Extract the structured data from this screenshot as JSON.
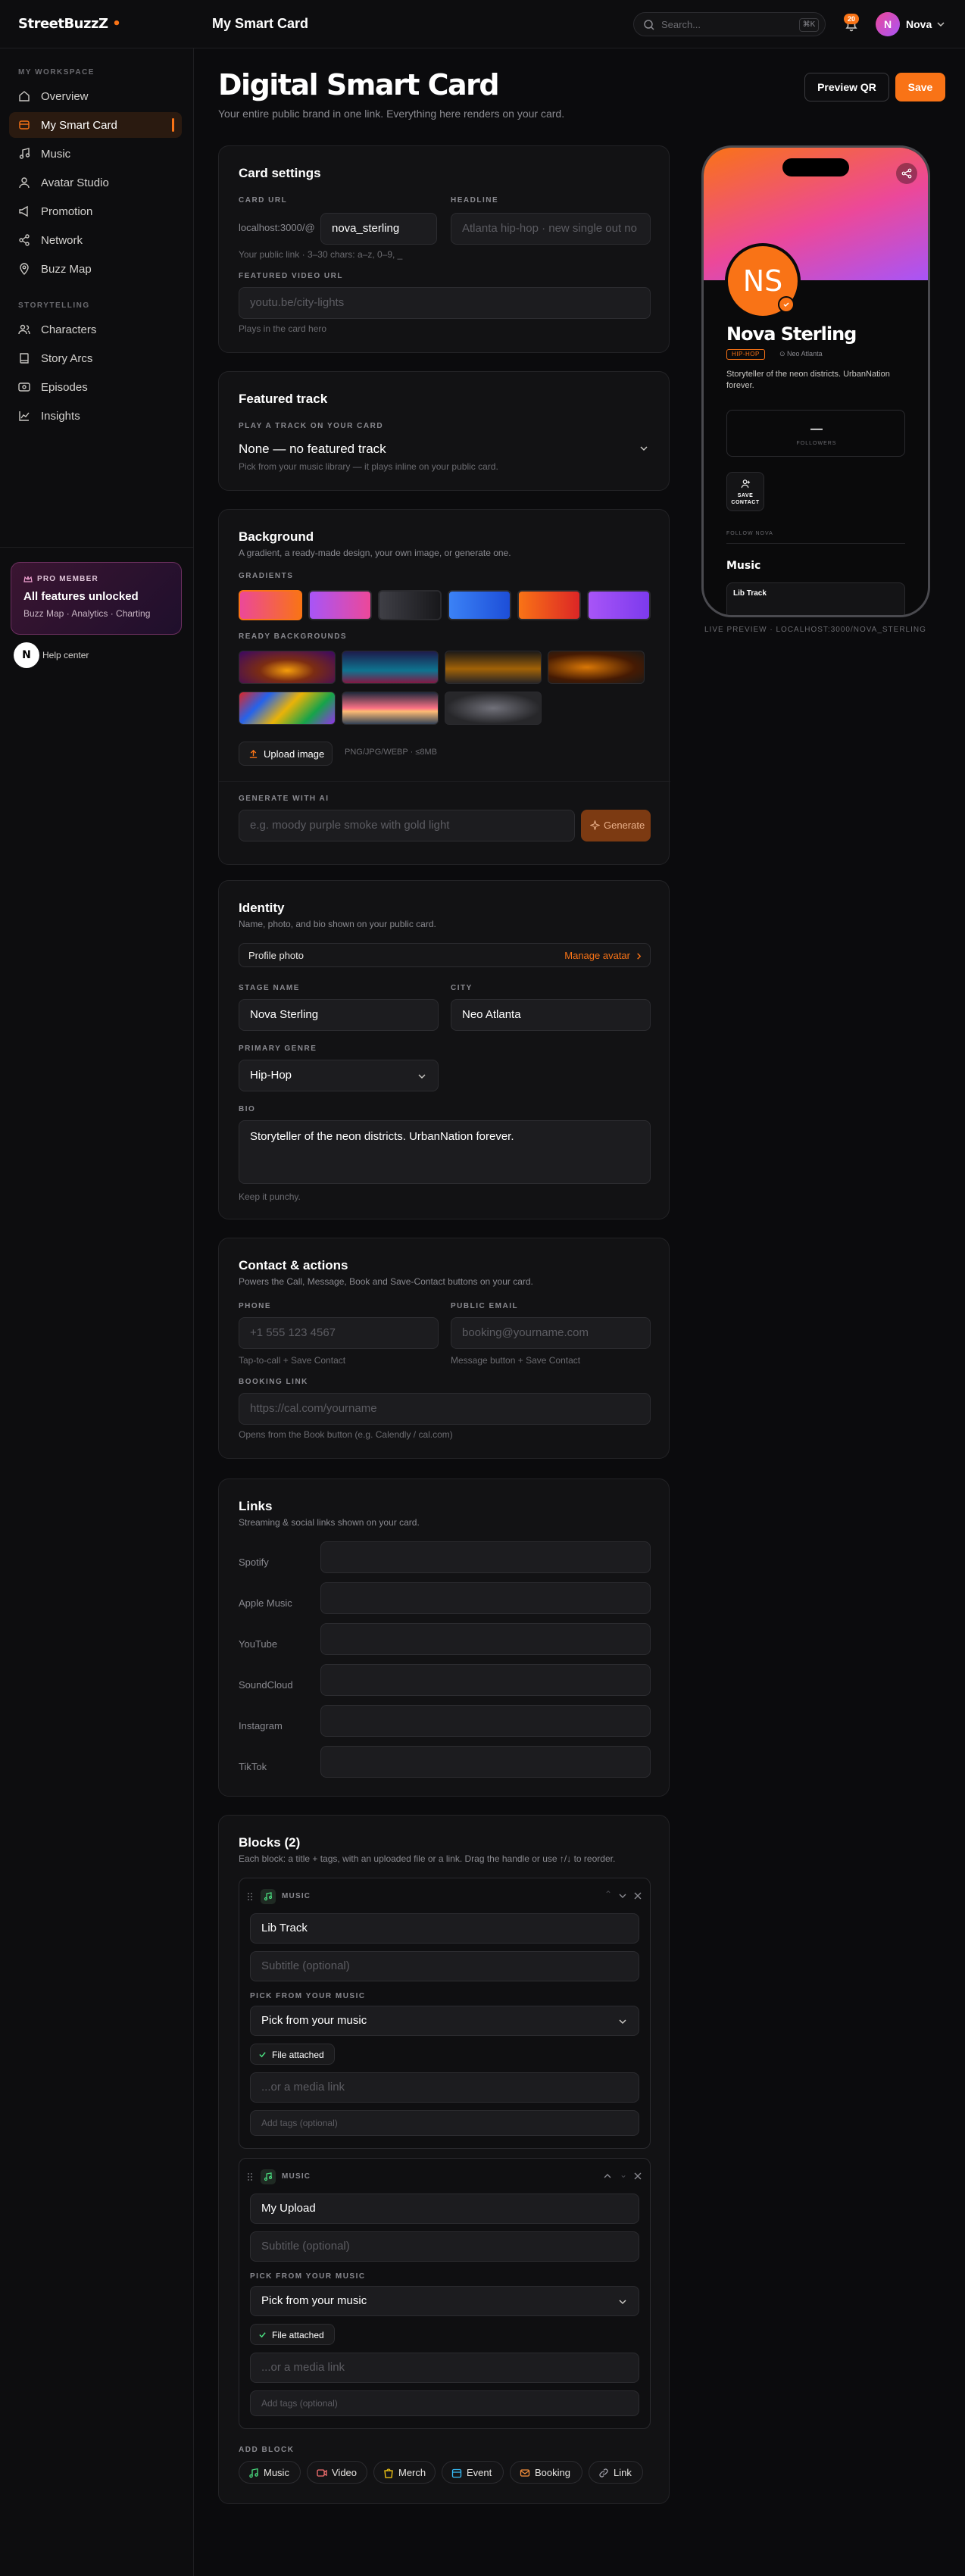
{
  "brand": {
    "name": "StreetBuzzZ",
    "dot": "•"
  },
  "header": {
    "title": "My Smart Card",
    "search_placeholder": "Search...",
    "search_kbd": "⌘K",
    "notif_count": "20",
    "user_initial": "N",
    "user_name": "Nova"
  },
  "sidebar": {
    "workspace_label": "MY WORKSPACE",
    "workspace_items": [
      {
        "label": "Overview",
        "icon": "home-icon"
      },
      {
        "label": "My Smart Card",
        "icon": "card-icon",
        "active": true
      },
      {
        "label": "Music",
        "icon": "music-note-icon"
      },
      {
        "label": "Avatar Studio",
        "icon": "user-icon"
      },
      {
        "label": "Promotion",
        "icon": "megaphone-icon"
      },
      {
        "label": "Network",
        "icon": "share-icon"
      },
      {
        "label": "Buzz Map",
        "icon": "map-pin-icon"
      }
    ],
    "story_label": "STORYTELLING",
    "story_items": [
      {
        "label": "Characters",
        "icon": "users-icon"
      },
      {
        "label": "Story Arcs",
        "icon": "book-icon"
      },
      {
        "label": "Episodes",
        "icon": "film-icon"
      },
      {
        "label": "Insights",
        "icon": "chart-icon"
      }
    ],
    "pro": {
      "label": "PRO MEMBER",
      "title": "All features unlocked",
      "features": "Buzz Map · Analytics · Charting"
    },
    "help": {
      "initial": "N",
      "label": "Help center"
    }
  },
  "page": {
    "title": "Digital Smart Card",
    "subtitle": "Your entire public brand in one link. Everything here renders on your card.",
    "preview_qr": "Preview QR",
    "save": "Save"
  },
  "card_settings": {
    "title": "Card settings",
    "url_label": "CARD URL",
    "url_prefix": "localhost:3000/@",
    "url_value": "nova_sterling",
    "url_hint": "Your public link · 3–30 chars: a–z, 0–9, _",
    "headline_label": "HEADLINE",
    "headline_placeholder": "Atlanta hip-hop · new single out no",
    "video_label": "FEATURED VIDEO URL",
    "video_placeholder": "youtu.be/city-lights",
    "video_hint": "Plays in the card hero"
  },
  "featured": {
    "title": "Featured track",
    "label": "PLAY A TRACK ON YOUR CARD",
    "value": "None — no featured track",
    "hint": "Pick from your music library — it plays inline on your public card."
  },
  "background": {
    "title": "Background",
    "subtitle": "A gradient, a ready-made design, your own image, or generate one.",
    "gradients_label": "GRADIENTS",
    "gradients": [
      "linear-gradient(90deg,#ec4899,#f97316)",
      "linear-gradient(90deg,#a855f7,#ec4899)",
      "linear-gradient(90deg,#3f3f46,#18181b)",
      "linear-gradient(90deg,#3b82f6,#1d4ed8)",
      "linear-gradient(90deg,#f97316,#dc2626)",
      "linear-gradient(90deg,#a855f7,#7c3aed)"
    ],
    "ready_label": "READY BACKGROUNDS",
    "upload": "Upload image",
    "upload_hint": "PNG/JPG/WEBP · ≤8MB",
    "ai_label": "GENERATE WITH AI",
    "ai_placeholder": "e.g. moody purple smoke with gold light",
    "ai_button": "Generate"
  },
  "identity": {
    "title": "Identity",
    "subtitle": "Name, photo, and bio shown on your public card.",
    "photo_label": "Profile photo",
    "manage": "Manage avatar",
    "stage_label": "STAGE NAME",
    "stage_value": "Nova Sterling",
    "city_label": "CITY",
    "city_value": "Neo Atlanta",
    "genre_label": "PRIMARY GENRE",
    "genre_value": "Hip-Hop",
    "bio_label": "BIO",
    "bio_value": "Storyteller of the neon districts. UrbanNation forever.",
    "bio_hint": "Keep it punchy."
  },
  "contact": {
    "title": "Contact & actions",
    "subtitle": "Powers the Call, Message, Book and Save-Contact buttons on your card.",
    "phone_label": "PHONE",
    "phone_placeholder": "+1 555 123 4567",
    "phone_hint": "Tap-to-call + Save Contact",
    "email_label": "PUBLIC EMAIL",
    "email_placeholder": "booking@yourname.com",
    "email_hint": "Message button + Save Contact",
    "booking_label": "BOOKING LINK",
    "booking_placeholder": "https://cal.com/yourname",
    "booking_hint": "Opens from the Book button (e.g. Calendly / cal.com)"
  },
  "links": {
    "title": "Links",
    "subtitle": "Streaming & social links shown on your card.",
    "rows": [
      "Spotify",
      "Apple Music",
      "YouTube",
      "SoundCloud",
      "Instagram",
      "TikTok"
    ]
  },
  "blocks": {
    "title": "Blocks (2)",
    "subtitle": "Each block: a title + tags, with an uploaded file or a link. Drag the handle or use ↑/↓ to reorder.",
    "items": [
      {
        "type": "MUSIC",
        "title": "Lib Track",
        "subtitle_placeholder": "Subtitle (optional)",
        "pick_label": "PICK FROM YOUR MUSIC",
        "pick_value": "Pick from your music",
        "file": "File attached",
        "link_placeholder": "...or a media link",
        "tags_placeholder": "Add tags (optional)"
      },
      {
        "type": "MUSIC",
        "title": "My Upload",
        "subtitle_placeholder": "Subtitle (optional)",
        "pick_label": "PICK FROM YOUR MUSIC",
        "pick_value": "Pick from your music",
        "file": "File attached",
        "link_placeholder": "...or a media link",
        "tags_placeholder": "Add tags (optional)"
      }
    ],
    "add_label": "ADD BLOCK",
    "add": [
      "Music",
      "Video",
      "Merch",
      "Event",
      "Booking",
      "Link"
    ]
  },
  "preview": {
    "initials": "NS",
    "name": "Nova Sterling",
    "genre": "HIP-HOP",
    "city": "⊙ Neo Atlanta",
    "bio": "Storyteller of the neon districts. UrbanNation forever.",
    "followers_value": "—",
    "followers_label": "FOLLOWERS",
    "save_contact": "SAVE CONTACT",
    "follow": "FOLLOW NOVA",
    "music": "Music",
    "track": "Lib Track",
    "live": "LIVE PREVIEW · LOCALHOST:3000/NOVA_STERLING"
  },
  "colors": {
    "accent": "#f97316",
    "bg": "#0b0b0d",
    "card": "#121214"
  }
}
